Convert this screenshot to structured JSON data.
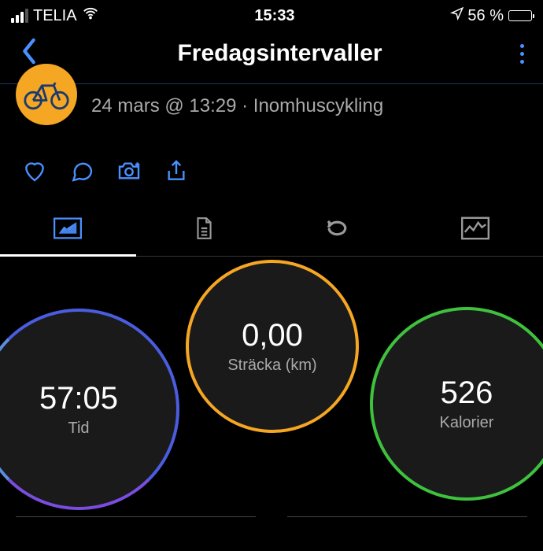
{
  "status": {
    "carrier": "TELIA",
    "time": "15:33",
    "battery_text": "56 %"
  },
  "header": {
    "title": "Fredagsintervaller"
  },
  "activity": {
    "subtitle": "24 mars @ 13:29 · Inomhuscykling"
  },
  "metrics": {
    "time": {
      "value": "57:05",
      "label": "Tid"
    },
    "distance": {
      "value": "0,00",
      "label": "Sträcka (km)"
    },
    "calories": {
      "value": "526",
      "label": "Kalorier"
    }
  }
}
